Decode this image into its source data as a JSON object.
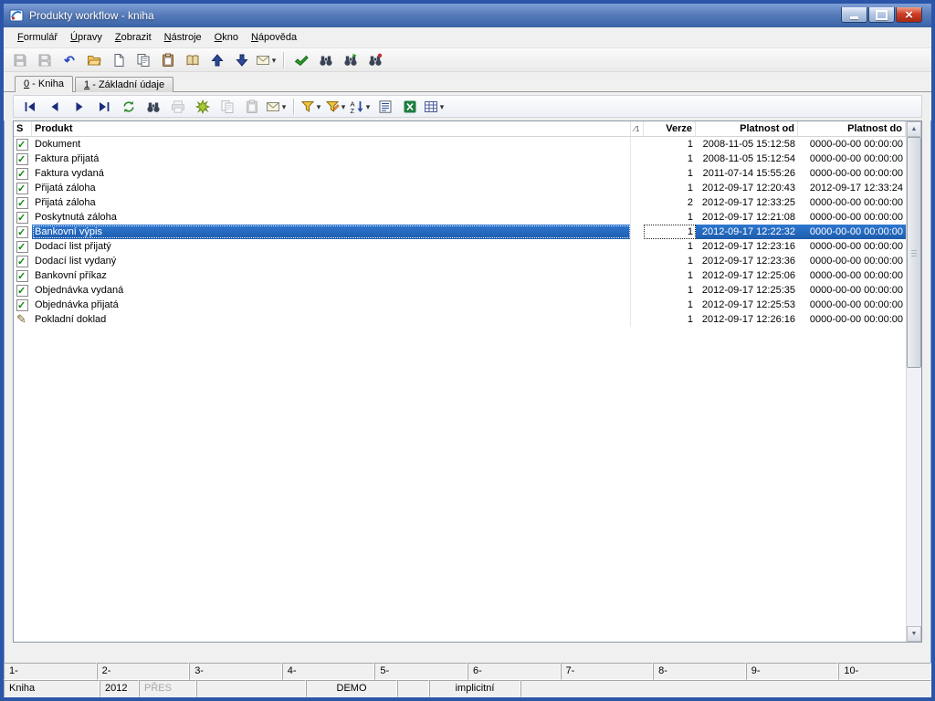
{
  "window": {
    "title": "Produkty workflow - kniha"
  },
  "colors": {
    "window_border": "#2b55a8",
    "titlebar_top": "#7f9fd6",
    "titlebar_bottom": "#3a63a8",
    "close_button": "#cf3d24",
    "selection": "#2d77cf",
    "selection_dark": "#1e5cad",
    "check_green": "#0a8a0a"
  },
  "menu": {
    "items": [
      "Formulář",
      "Úpravy",
      "Zobrazit",
      "Nástroje",
      "Okno",
      "Nápověda"
    ]
  },
  "toolbar_main": {
    "items": [
      {
        "icon": "save",
        "disabled": true
      },
      {
        "icon": "save-record",
        "disabled": true
      },
      {
        "icon": "undo"
      },
      {
        "icon": "open-folder"
      },
      {
        "icon": "new-document"
      },
      {
        "icon": "copy"
      },
      {
        "icon": "paste"
      },
      {
        "icon": "book"
      },
      {
        "icon": "move-up"
      },
      {
        "icon": "move-down"
      },
      {
        "icon": "mail",
        "dropdown": true
      },
      {
        "sep": true
      },
      {
        "icon": "run"
      },
      {
        "icon": "find"
      },
      {
        "icon": "find-next"
      },
      {
        "icon": "find-special"
      }
    ]
  },
  "tabs": [
    {
      "label": "0 - Kniha",
      "active": true
    },
    {
      "label": "1 - Základní údaje",
      "active": false
    }
  ],
  "toolbar_grid": {
    "items": [
      {
        "icon": "nav-first"
      },
      {
        "icon": "nav-prev"
      },
      {
        "icon": "nav-next"
      },
      {
        "icon": "nav-last"
      },
      {
        "icon": "refresh"
      },
      {
        "icon": "find"
      },
      {
        "icon": "print",
        "disabled": true
      },
      {
        "icon": "star"
      },
      {
        "icon": "copy-record",
        "disabled": true
      },
      {
        "icon": "paste-record",
        "disabled": true
      },
      {
        "icon": "mail",
        "dropdown": true
      },
      {
        "sep": true
      },
      {
        "icon": "filter",
        "dropdown": true
      },
      {
        "icon": "filter-edit",
        "dropdown": true
      },
      {
        "icon": "sort-az",
        "dropdown": true
      },
      {
        "icon": "summary"
      },
      {
        "icon": "excel"
      },
      {
        "icon": "table-view",
        "dropdown": true
      }
    ]
  },
  "grid": {
    "header": {
      "s": "S",
      "produkt": "Produkt",
      "sort_badge": "1",
      "verze": "Verze",
      "platnost_od": "Platnost od",
      "platnost_do": "Platnost do"
    },
    "rows": [
      {
        "status": "checked",
        "produkt": "Dokument",
        "verze": "1",
        "platnost_od": "2008-11-05 15:12:58",
        "platnost_do": "0000-00-00 00:00:00"
      },
      {
        "status": "checked",
        "produkt": "Faktura přijatá",
        "verze": "1",
        "platnost_od": "2008-11-05 15:12:54",
        "platnost_do": "0000-00-00 00:00:00"
      },
      {
        "status": "checked",
        "produkt": "Faktura vydaná",
        "verze": "1",
        "platnost_od": "2011-07-14 15:55:26",
        "platnost_do": "0000-00-00 00:00:00"
      },
      {
        "status": "checked",
        "produkt": "Přijatá záloha",
        "verze": "1",
        "platnost_od": "2012-09-17 12:20:43",
        "platnost_do": "2012-09-17 12:33:24"
      },
      {
        "status": "checked",
        "produkt": "Přijatá záloha",
        "verze": "2",
        "platnost_od": "2012-09-17 12:33:25",
        "platnost_do": "0000-00-00 00:00:00"
      },
      {
        "status": "checked",
        "produkt": "Poskytnutá záloha",
        "verze": "1",
        "platnost_od": "2012-09-17 12:21:08",
        "platnost_do": "0000-00-00 00:00:00"
      },
      {
        "status": "checked",
        "produkt": "Bankovní výpis",
        "verze": "1",
        "platnost_od": "2012-09-17 12:22:32",
        "platnost_do": "0000-00-00 00:00:00",
        "selected": true
      },
      {
        "status": "checked",
        "produkt": "Dodací list přijatý",
        "verze": "1",
        "platnost_od": "2012-09-17 12:23:16",
        "platnost_do": "0000-00-00 00:00:00"
      },
      {
        "status": "checked",
        "produkt": "Dodací list vydaný",
        "verze": "1",
        "platnost_od": "2012-09-17 12:23:36",
        "platnost_do": "0000-00-00 00:00:00"
      },
      {
        "status": "checked",
        "produkt": "Bankovní příkaz",
        "verze": "1",
        "platnost_od": "2012-09-17 12:25:06",
        "platnost_do": "0000-00-00 00:00:00"
      },
      {
        "status": "checked",
        "produkt": "Objednávka vydaná",
        "verze": "1",
        "platnost_od": "2012-09-17 12:25:35",
        "platnost_do": "0000-00-00 00:00:00"
      },
      {
        "status": "checked",
        "produkt": "Objednávka přijatá",
        "verze": "1",
        "platnost_od": "2012-09-17 12:25:53",
        "platnost_do": "0000-00-00 00:00:00"
      },
      {
        "status": "edit",
        "produkt": "Pokladní doklad",
        "verze": "1",
        "platnost_od": "2012-09-17 12:26:16",
        "platnost_do": "0000-00-00 00:00:00"
      }
    ]
  },
  "statusbar": {
    "row1": [
      "1-",
      "2-",
      "3-",
      "4-",
      "5-",
      "6-",
      "7-",
      "8-",
      "9-",
      "10-"
    ],
    "row2": [
      {
        "text": "Kniha"
      },
      {
        "text": "2012"
      },
      {
        "text": "PŘES",
        "muted": true
      },
      {
        "text": ""
      },
      {
        "text": "DEMO",
        "center": true
      },
      {
        "text": ""
      },
      {
        "text": "implicitní",
        "center": true
      },
      {
        "text": ""
      }
    ]
  }
}
